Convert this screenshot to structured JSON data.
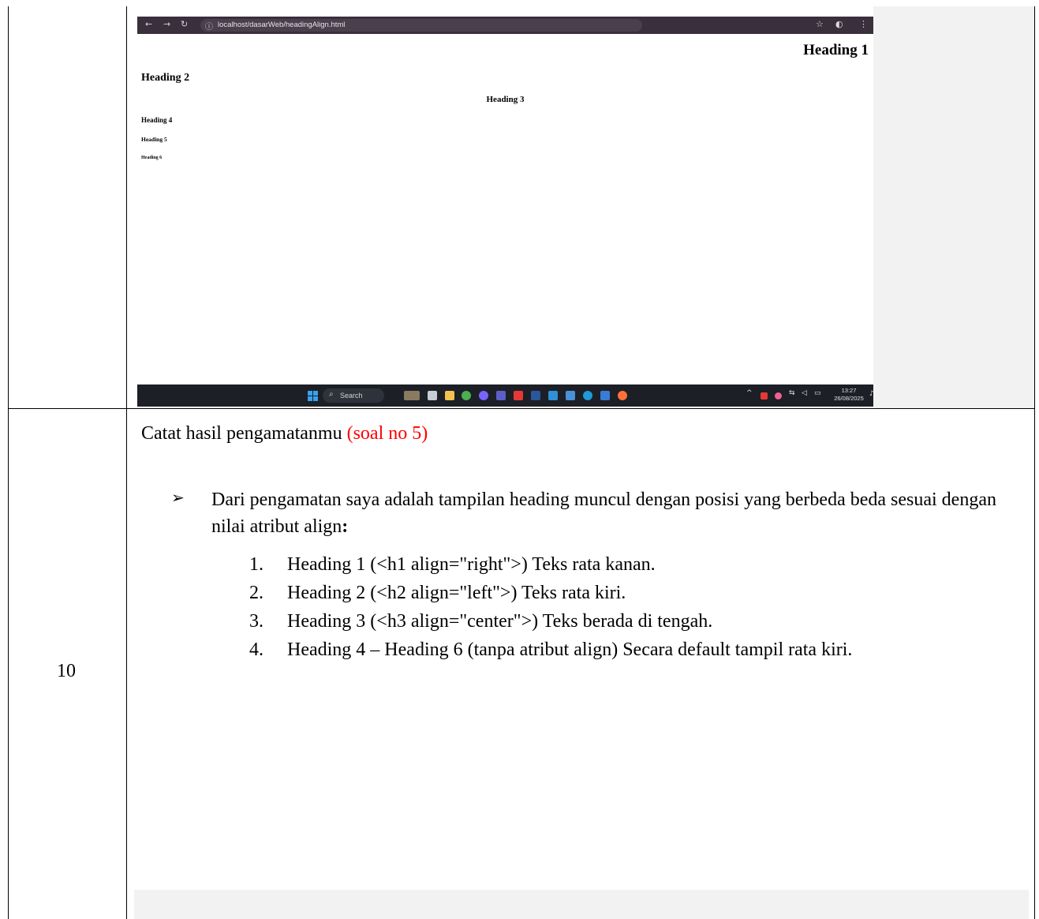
{
  "browser": {
    "url": "localhost/dasarWeb/headingAlign.html",
    "back_icon": "arrow-left-icon",
    "forward_icon": "arrow-right-icon",
    "reload_icon": "reload-icon",
    "info_icon": "info-icon",
    "star_icon": "star-icon",
    "profile_icon": "profile-icon",
    "menu_icon": "kebab-menu-icon"
  },
  "page_headings": {
    "h1": "Heading 1",
    "h2": "Heading 2",
    "h3": "Heading 3",
    "h4": "Heading 4",
    "h5": "Heading 5",
    "h6": "Heading 6"
  },
  "taskbar": {
    "search_label": "Search",
    "time": "13:27",
    "date": "26/08/2025",
    "accent_color": "#39a0ee"
  },
  "row": {
    "number": "10",
    "title_main": "Catat hasil pengamatanmu ",
    "title_note": "(soal no 5)",
    "title_note_color": "#ff0000",
    "bullet_text": "Dari pengamatan saya adalah tampilan heading muncul dengan posisi yang berbeda beda sesuai dengan nilai atribut align",
    "bullet_colon": ":",
    "items": [
      {
        "num": "1.",
        "text": "Heading 1 (<h1 align=\"right\">) Teks rata kanan."
      },
      {
        "num": "2.",
        "text": "Heading 2 (<h2 align=\"left\">) Teks rata kiri."
      },
      {
        "num": "3.",
        "text": "Heading 3 (<h3 align=\"center\">) Teks berada di tengah."
      },
      {
        "num": "4.",
        "text": "Heading 4 – Heading 6 (tanpa atribut align) Secara default tampil rata kiri."
      }
    ]
  }
}
